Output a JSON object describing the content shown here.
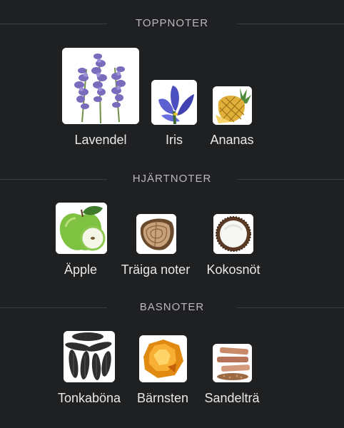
{
  "sections": [
    {
      "title": "TOPPNOTER",
      "notes": [
        {
          "name": "Lavendel",
          "icon": "lavender-icon"
        },
        {
          "name": "Iris",
          "icon": "iris-flower-icon"
        },
        {
          "name": "Ananas",
          "icon": "pineapple-icon"
        }
      ]
    },
    {
      "title": "HJÄRTNOTER",
      "notes": [
        {
          "name": "Äpple",
          "icon": "green-apple-icon"
        },
        {
          "name": "Träiga noter",
          "icon": "wood-slice-icon"
        },
        {
          "name": "Kokosnöt",
          "icon": "coconut-icon"
        }
      ]
    },
    {
      "title": "BASNOTER",
      "notes": [
        {
          "name": "Tonkaböna",
          "icon": "tonka-bean-icon"
        },
        {
          "name": "Bärnsten",
          "icon": "amber-icon"
        },
        {
          "name": "Sandelträ",
          "icon": "sandalwood-icon"
        }
      ]
    }
  ],
  "colors": {
    "background": "#1f2022",
    "divider": "#3a3b3e",
    "section_title": "#b9b9bb",
    "label": "#e8e8e8"
  }
}
